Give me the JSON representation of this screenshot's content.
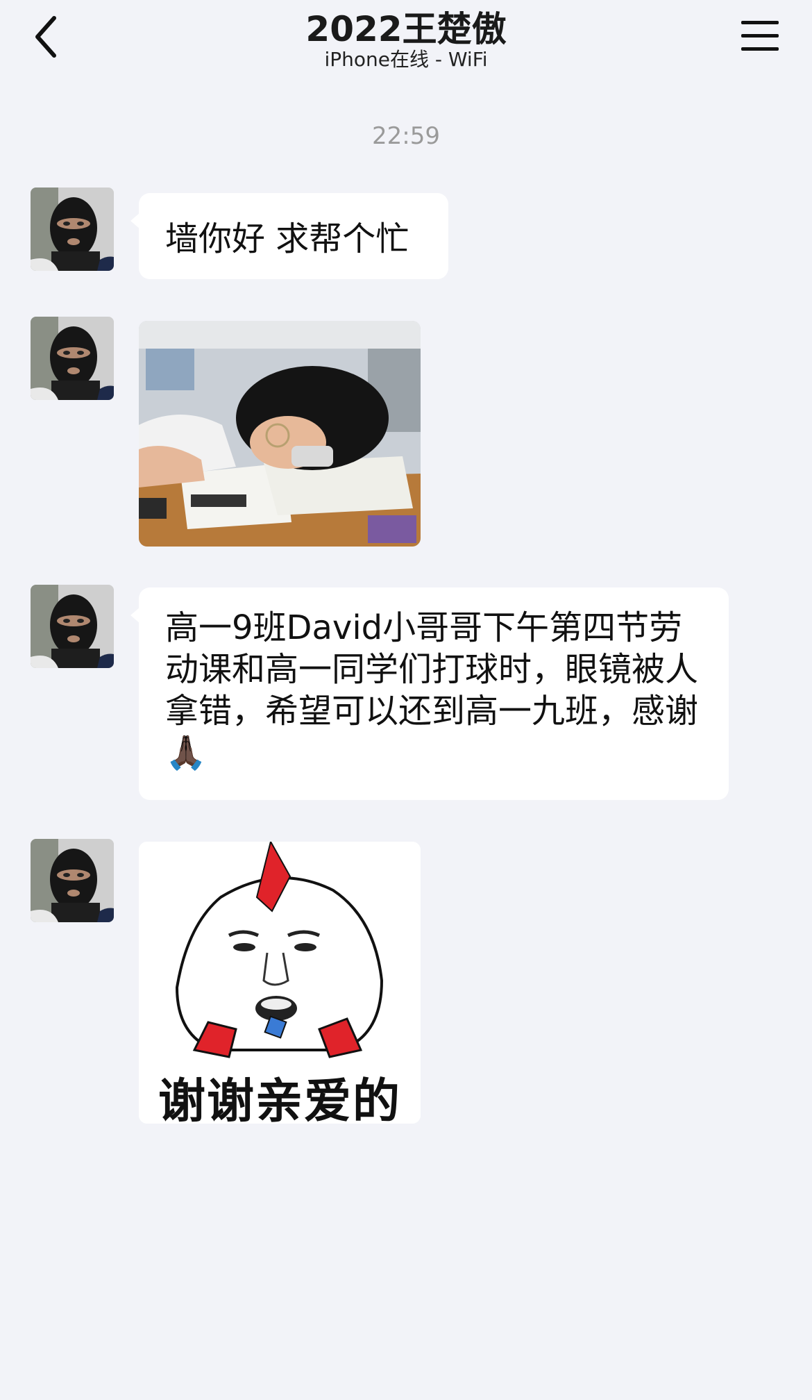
{
  "header": {
    "title": "2022王楚傲",
    "subtitle": "iPhone在线 - WiFi",
    "back_icon": "chevron-left-icon",
    "menu_icon": "hamburger-menu-icon"
  },
  "chat": {
    "timestamp": "22:59",
    "messages": [
      {
        "type": "text",
        "text": "墙你好 求帮个忙"
      },
      {
        "type": "image",
        "description_icon": "photo"
      },
      {
        "type": "text",
        "text": "高一9班David小哥哥下午第四节劳动课和高一同学们打球时，眼镜被人拿错，希望可以还到高一九班，感谢🙏🏿"
      },
      {
        "type": "sticker",
        "caption": "谢谢亲爱的"
      }
    ]
  },
  "colors": {
    "background": "#f2f3f8",
    "bubble": "#ffffff",
    "timestamp": "#9a9a9a"
  }
}
